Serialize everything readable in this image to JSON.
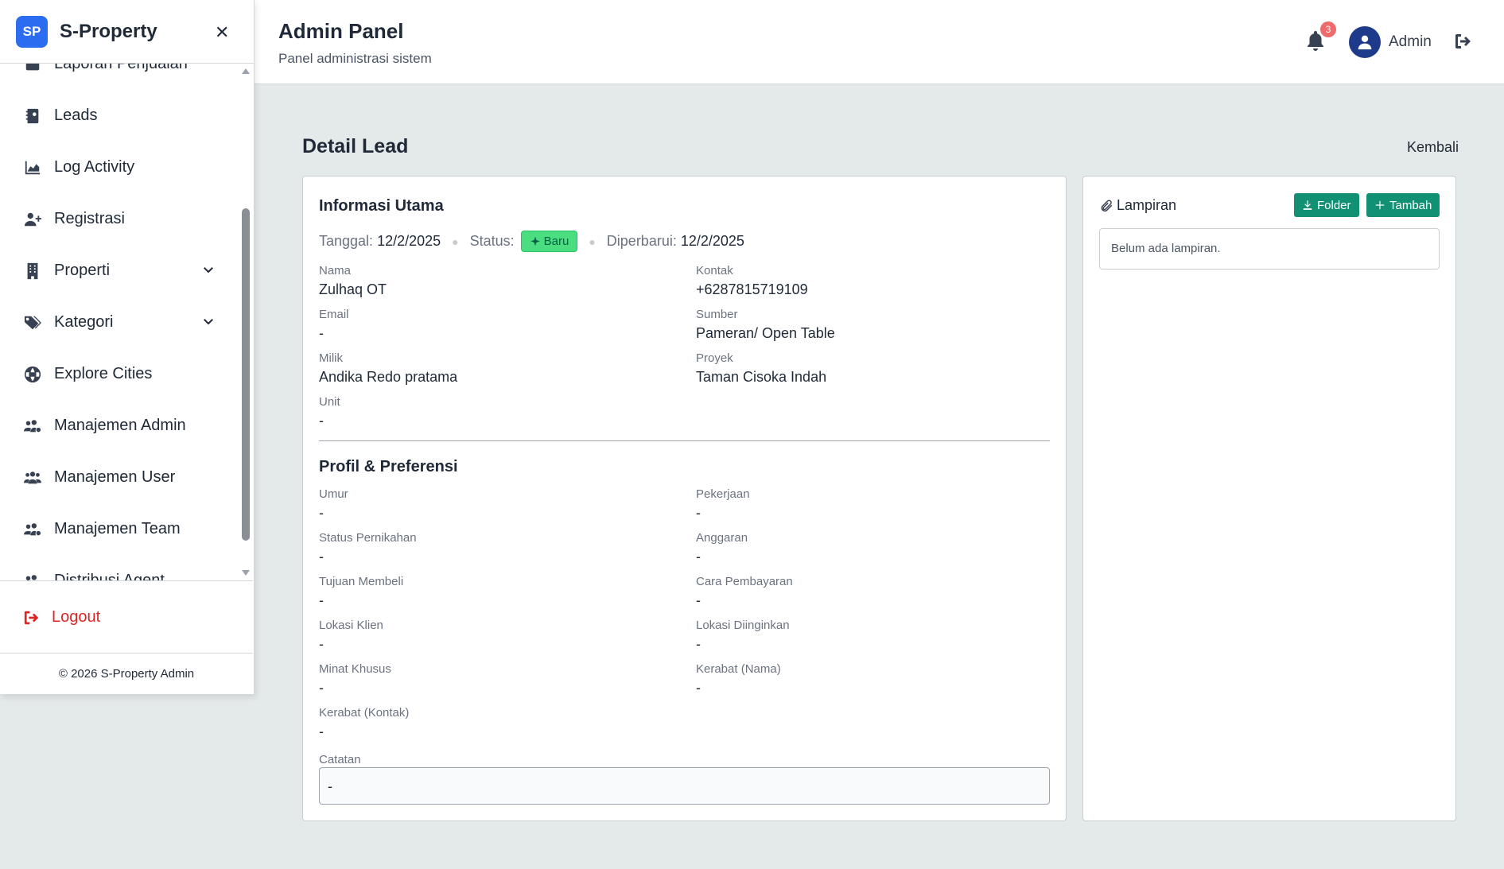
{
  "sidebar": {
    "brand_logo": "SP",
    "brand_name": "S-Property",
    "items": [
      {
        "label": "Laporan Penjualan",
        "icon": "report-icon"
      },
      {
        "label": "Leads",
        "icon": "address-book-icon"
      },
      {
        "label": "Log Activity",
        "icon": "chart-area-icon"
      },
      {
        "label": "Registrasi",
        "icon": "user-plus-icon"
      },
      {
        "label": "Properti",
        "icon": "building-icon",
        "expandable": true
      },
      {
        "label": "Kategori",
        "icon": "tags-icon",
        "expandable": true
      },
      {
        "label": "Explore Cities",
        "icon": "globe-icon"
      },
      {
        "label": "Manajemen Admin",
        "icon": "users-gear-icon"
      },
      {
        "label": "Manajemen User",
        "icon": "users-icon"
      },
      {
        "label": "Manajemen Team",
        "icon": "users-gear-icon"
      },
      {
        "label": "Distribusi Agent",
        "icon": "users-gear-icon"
      }
    ],
    "logout_label": "Logout",
    "copyright": "© 2026 S-Property Admin"
  },
  "header": {
    "title": "Admin Panel",
    "subtitle": "Panel administrasi sistem",
    "notification_count": "3",
    "user_name": "Admin"
  },
  "page": {
    "title": "Detail Lead",
    "back_label": "Kembali"
  },
  "info": {
    "section_title": "Informasi Utama",
    "date_label": "Tanggal:",
    "date_value": "12/2/2025",
    "status_label": "Status:",
    "status_value": "Baru",
    "updated_label": "Diperbarui:",
    "updated_value": "12/2/2025",
    "fields": {
      "nama": {
        "label": "Nama",
        "value": "Zulhaq OT"
      },
      "kontak": {
        "label": "Kontak",
        "value": "+6287815719109"
      },
      "email": {
        "label": "Email",
        "value": "-"
      },
      "sumber": {
        "label": "Sumber",
        "value": "Pameran/ Open Table"
      },
      "milik": {
        "label": "Milik",
        "value": "Andika Redo pratama"
      },
      "proyek": {
        "label": "Proyek",
        "value": "Taman Cisoka Indah"
      },
      "unit": {
        "label": "Unit",
        "value": "-"
      }
    }
  },
  "profile": {
    "section_title": "Profil & Preferensi",
    "fields": {
      "umur": {
        "label": "Umur",
        "value": "-"
      },
      "pekerjaan": {
        "label": "Pekerjaan",
        "value": "-"
      },
      "status_pernikahan": {
        "label": "Status Pernikahan",
        "value": "-"
      },
      "anggaran": {
        "label": "Anggaran",
        "value": "-"
      },
      "tujuan_membeli": {
        "label": "Tujuan Membeli",
        "value": "-"
      },
      "cara_pembayaran": {
        "label": "Cara Pembayaran",
        "value": "-"
      },
      "lokasi_klien": {
        "label": "Lokasi Klien",
        "value": "-"
      },
      "lokasi_diinginkan": {
        "label": "Lokasi Diinginkan",
        "value": "-"
      },
      "minat_khusus": {
        "label": "Minat Khusus",
        "value": "-"
      },
      "kerabat_nama": {
        "label": "Kerabat (Nama)",
        "value": "-"
      },
      "kerabat_kontak": {
        "label": "Kerabat (Kontak)",
        "value": "-"
      }
    },
    "note_label": "Catatan",
    "note_value": "-"
  },
  "attachments": {
    "title": "Lampiran",
    "folder_label": "Folder",
    "add_label": "Tambah",
    "empty_text": "Belum ada lampiran."
  },
  "colors": {
    "brand": "#2b6cf0",
    "accent_button": "#119074",
    "status_badge": "#4ade80",
    "logout": "#dc2626",
    "avatar": "#1e3a8a"
  }
}
